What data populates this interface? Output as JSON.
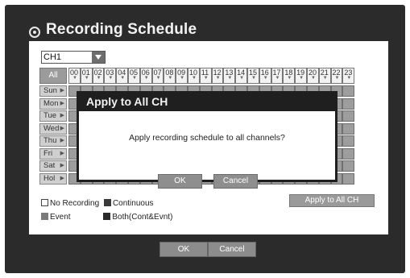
{
  "window": {
    "title": "Recording Schedule"
  },
  "channel": {
    "selected": "CH1"
  },
  "grid": {
    "all_label": "All",
    "hours": [
      "00",
      "01",
      "02",
      "03",
      "04",
      "05",
      "06",
      "07",
      "08",
      "09",
      "10",
      "11",
      "12",
      "13",
      "14",
      "15",
      "16",
      "17",
      "18",
      "19",
      "20",
      "21",
      "22",
      "23"
    ],
    "days": [
      "Sun",
      "Mon",
      "Tue",
      "Wed",
      "Thu",
      "Fri",
      "Sat",
      "Hol"
    ]
  },
  "legend": {
    "no_recording": "No Recording",
    "continuous": "Continuous",
    "event": "Event",
    "both": "Both(Cont&Evnt)"
  },
  "apply_all_button": "Apply to All CH",
  "dialog": {
    "title": "Apply to All CH",
    "message": "Apply recording schedule to all channels?",
    "ok": "OK",
    "cancel": "Cancel"
  },
  "footer": {
    "ok": "OK",
    "cancel": "Cancel"
  },
  "colors": {
    "frame": "#2b2b2b",
    "cell": "#9d9d9d",
    "day": "#cfcfcf",
    "button": "#8c8c8c"
  }
}
